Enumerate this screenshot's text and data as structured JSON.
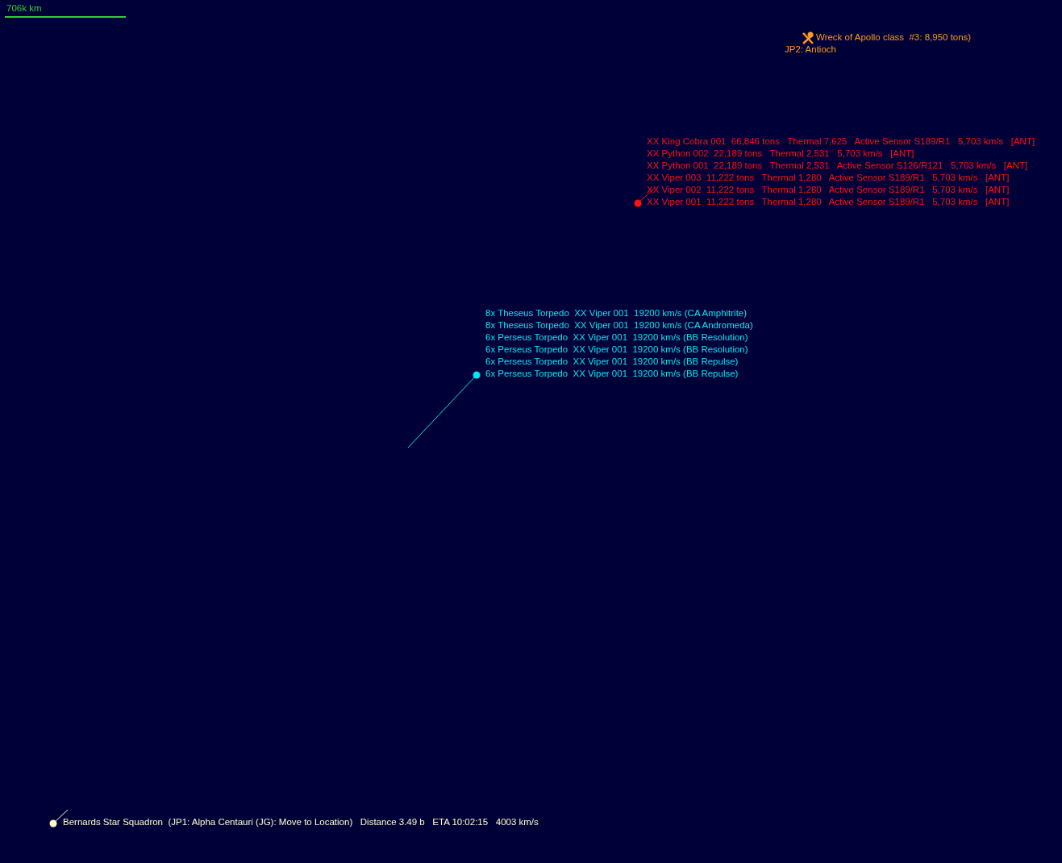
{
  "scale": {
    "label": "706k km"
  },
  "map_objects": [
    {
      "kind": "wreck",
      "lines": [
        "Wreck of Apollo class  #3: 8,950 tons)",
        "JP2: Antioch"
      ]
    },
    {
      "kind": "hostile",
      "lines": [
        "XX King Cobra 001  66,846 tons   Thermal 7,625   Active Sensor S189/R1   5,703 km/s   [ANT]",
        "XX Python 002  22,189 tons   Thermal 2,531   5,703 km/s   [ANT]",
        "XX Python 001  22,189 tons   Thermal 2,531   Active Sensor S126/R121   5,703 km/s   [ANT]",
        "XX Viper 003  11,222 tons   Thermal 1,280   Active Sensor S189/R1   5,703 km/s   [ANT]",
        "XX Viper 002  11,222 tons   Thermal 1,280   Active Sensor S189/R1   5,703 km/s   [ANT]",
        "XX Viper 001  11,222 tons   Thermal 1,280   Active Sensor S189/R1   5,703 km/s   [ANT]"
      ]
    },
    {
      "kind": "missile",
      "lines": [
        "8x Theseus Torpedo  XX Viper 001  19200 km/s (CA Amphitrite)",
        "8x Theseus Torpedo  XX Viper 001  19200 km/s (CA Andromeda)",
        "6x Perseus Torpedo  XX Viper 001  19200 km/s (BB Resolution)",
        "6x Perseus Torpedo  XX Viper 001  19200 km/s (BB Resolution)",
        "6x Perseus Torpedo  XX Viper 001  19200 km/s (BB Repulse)",
        "6x Perseus Torpedo  XX Viper 001  19200 km/s (BB Repulse)"
      ]
    },
    {
      "kind": "fleet",
      "lines": [
        "Bernards Star Squadron  (JP1: Alpha Centauri (JG): Move to Location)   Distance 3.49 b   ETA 10:02:15   4003 km/s"
      ]
    }
  ]
}
